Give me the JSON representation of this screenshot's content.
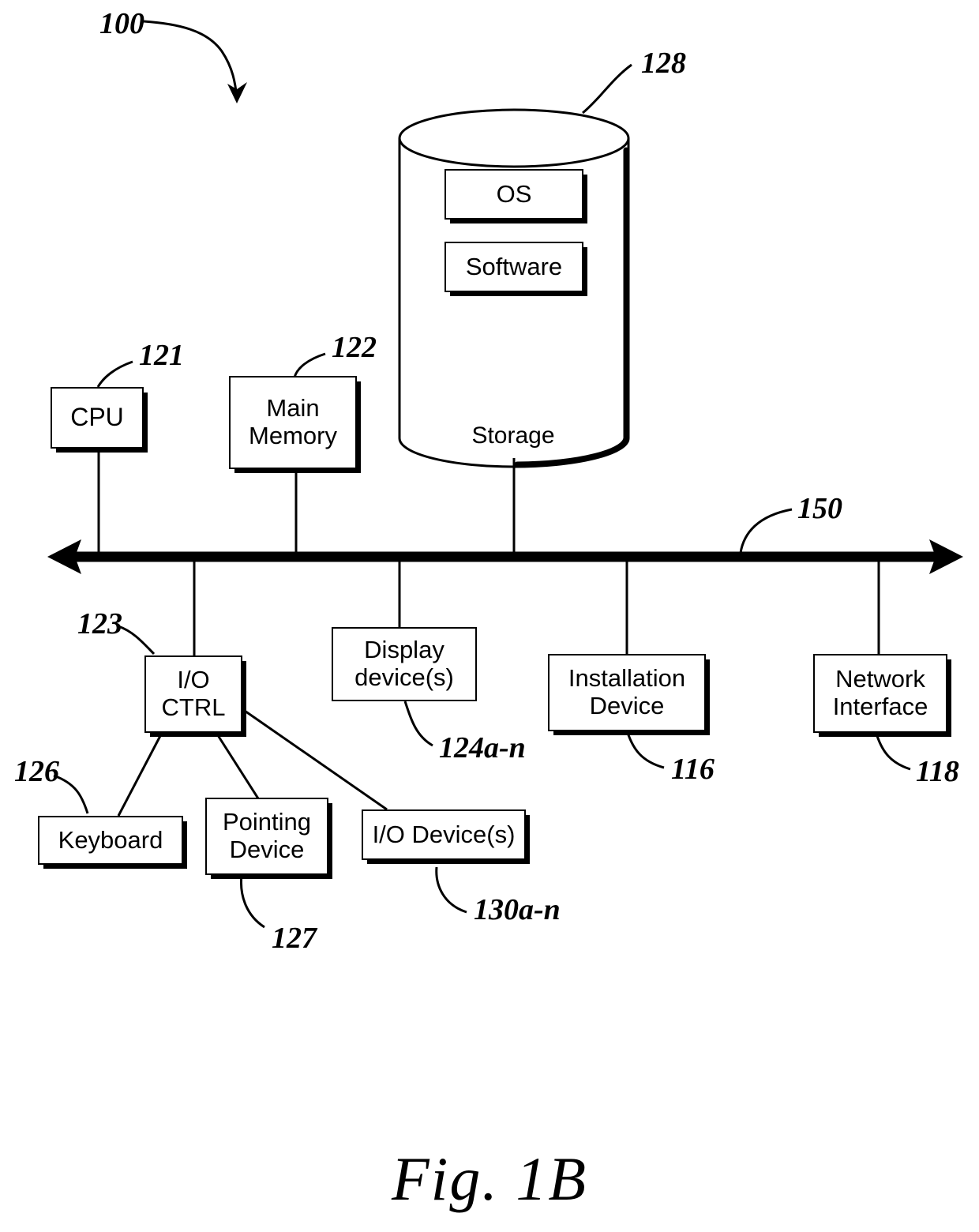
{
  "figure": {
    "caption": "Fig. 1B",
    "system_ref": "100",
    "bus_ref": "150"
  },
  "blocks": {
    "cpu": {
      "label": "CPU",
      "ref": "121"
    },
    "main_memory": {
      "label": "Main\nMemory",
      "line1": "Main",
      "line2": "Memory",
      "ref": "122"
    },
    "storage": {
      "label": "Storage",
      "ref": "128"
    },
    "os": {
      "label": "OS"
    },
    "software": {
      "label": "Software"
    },
    "io_ctrl": {
      "line1": "I/O",
      "line2": "CTRL",
      "ref": "123"
    },
    "display": {
      "line1": "Display",
      "line2": "device(s)",
      "ref": "124a-n"
    },
    "installation": {
      "line1": "Installation",
      "line2": "Device",
      "ref": "116"
    },
    "network": {
      "line1": "Network",
      "line2": "Interface",
      "ref": "118"
    },
    "keyboard": {
      "label": "Keyboard",
      "ref": "126"
    },
    "pointing": {
      "line1": "Pointing",
      "line2": "Device",
      "ref": "127"
    },
    "io_devices": {
      "label": "I/O Device(s)",
      "ref": "130a-n"
    }
  },
  "colors": {
    "ink": "#000000",
    "paper": "#ffffff"
  }
}
